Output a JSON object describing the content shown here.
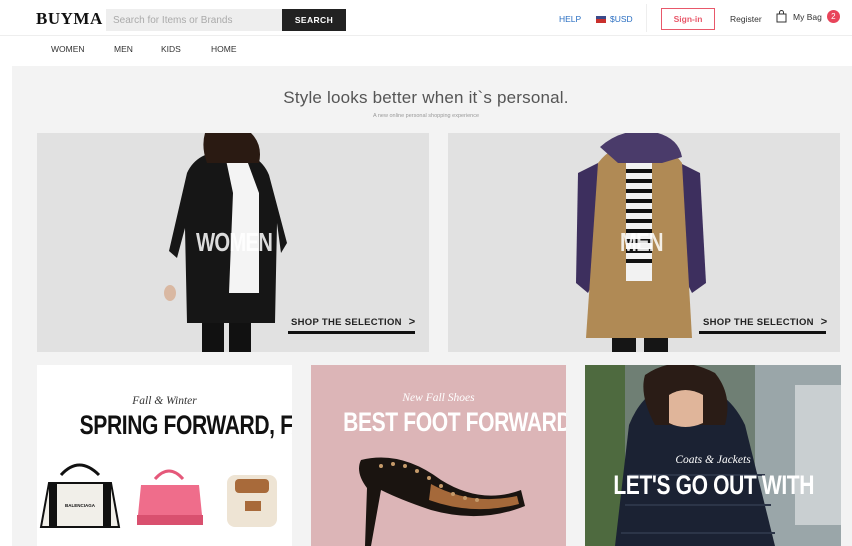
{
  "header": {
    "logo": "BUYMA",
    "search_placeholder": "Search for Items or Brands",
    "search_button": "SEARCH",
    "help": "HELP",
    "currency": "$USD",
    "signin": "Sign-in",
    "register": "Register",
    "bag_label": "My Bag",
    "bag_count": "2"
  },
  "nav": {
    "items": [
      {
        "label": "WOMEN"
      },
      {
        "label": "MEN"
      },
      {
        "label": "KIDS"
      },
      {
        "label": "HOME"
      }
    ]
  },
  "hero": {
    "tagline": "Style looks better when it`s personal.",
    "subtagline": "A new online personal shopping experience",
    "panels": [
      {
        "label": "WOMEN",
        "cta": "SHOP THE SELECTION"
      },
      {
        "label": "MEN",
        "cta": "SHOP THE SELECTION"
      }
    ]
  },
  "tiles": [
    {
      "script": "Fall & Winter",
      "headline": "SPRING FORWARD, FALL BAG",
      "bag_text": "BALENCIAGA"
    },
    {
      "script": "New Fall Shoes",
      "headline": "BEST FOOT FORWARD"
    },
    {
      "script": "Coats & Jackets",
      "headline": "LET'S GO OUT WITH"
    }
  ],
  "colors": {
    "accent": "#e8586a",
    "link": "#2b6fc2",
    "badge": "#e8445a",
    "tile_pink": "#dcb5b7"
  }
}
